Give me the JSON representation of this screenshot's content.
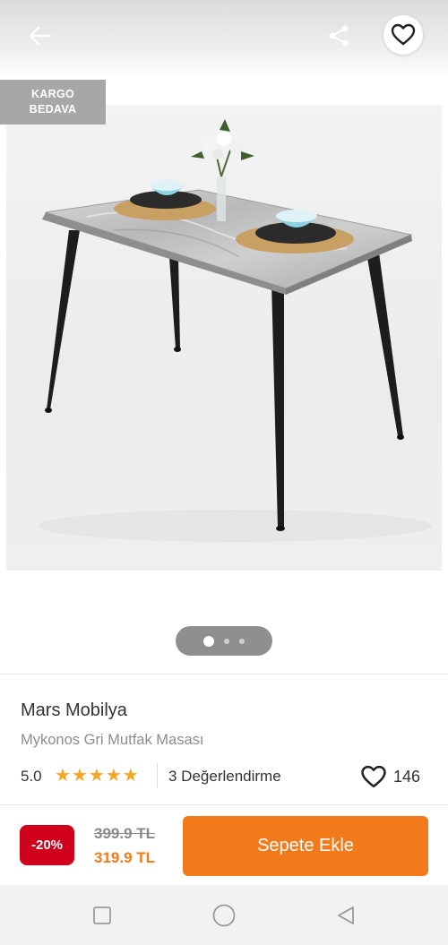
{
  "header": {
    "back_icon": "arrow-left-icon",
    "share_icon": "share-icon",
    "favorite_icon": "heart-outline-icon"
  },
  "gallery": {
    "badge_line1": "KARGO",
    "badge_line2": "BEDAVA",
    "image_count": 3,
    "active_index": 0
  },
  "product": {
    "brand": "Mars Mobilya",
    "name": "Mykonos Gri Mutfak Masası",
    "rating": "5.0",
    "stars": 5,
    "reviews": "3 Değerlendirme",
    "favorites": "146"
  },
  "price": {
    "discount": "-20%",
    "old_price": "399.9 TL",
    "new_price": "319.9 TL",
    "add_to_cart": "Sepete Ekle"
  },
  "navbar": {
    "recent_icon": "square-icon",
    "home_icon": "circle-icon",
    "back_icon": "triangle-back-icon"
  },
  "colors": {
    "accent": "#f27a1a",
    "discount": "#d0021b",
    "star": "#f5a623"
  }
}
